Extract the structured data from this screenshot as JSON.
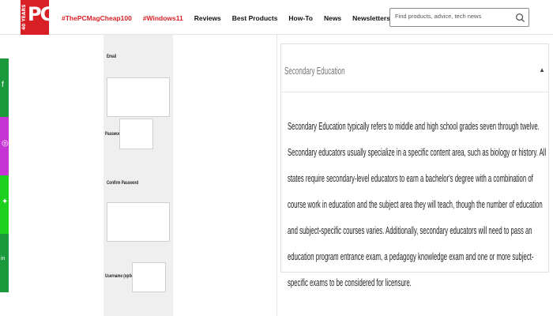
{
  "brand": {
    "logo_text": "PC",
    "logo_years": "40 YEARS",
    "logo_color": "#d81f26"
  },
  "nav": {
    "items": [
      {
        "label": "#ThePCMagCheap100",
        "highlight": true
      },
      {
        "label": "#Windows11",
        "highlight": true
      },
      {
        "label": "Reviews",
        "highlight": false
      },
      {
        "label": "Best Products",
        "highlight": false
      },
      {
        "label": "How-To",
        "highlight": false
      },
      {
        "label": "News",
        "highlight": false
      },
      {
        "label": "Newsletters",
        "highlight": false
      }
    ]
  },
  "search": {
    "placeholder": "Find products, advice, tech news"
  },
  "social": [
    {
      "name": "facebook",
      "icon": "f",
      "color": "#1a9a3a"
    },
    {
      "name": "instagram",
      "icon": "◎",
      "color": "#c634d6"
    },
    {
      "name": "twitter",
      "icon": "✦",
      "color": "#1fd11f"
    },
    {
      "name": "linkedin",
      "icon": "in",
      "color": "#1a9a3a"
    }
  ],
  "form": {
    "email_label": "Email",
    "password_label": "Password",
    "confirm_label": "Confirm Password",
    "username_label": "Username (optional)"
  },
  "card": {
    "title": "Secondary Education",
    "caret": "▲",
    "body": "Secondary Education typically refers to middle and high school grades seven through twelve. Secondary educators usually specialize in a specific content area, such as biology or history. All states require secondary-level educators to earn a bachelor's degree with a combination of course work in education and the subject area they will teach, though the number of education and subject-specific courses varies. Additionally, secondary educators will need to pass an education program entrance exam, a pedagogy knowledge exam and one or more subject-specific exams to be considered for licensure."
  }
}
